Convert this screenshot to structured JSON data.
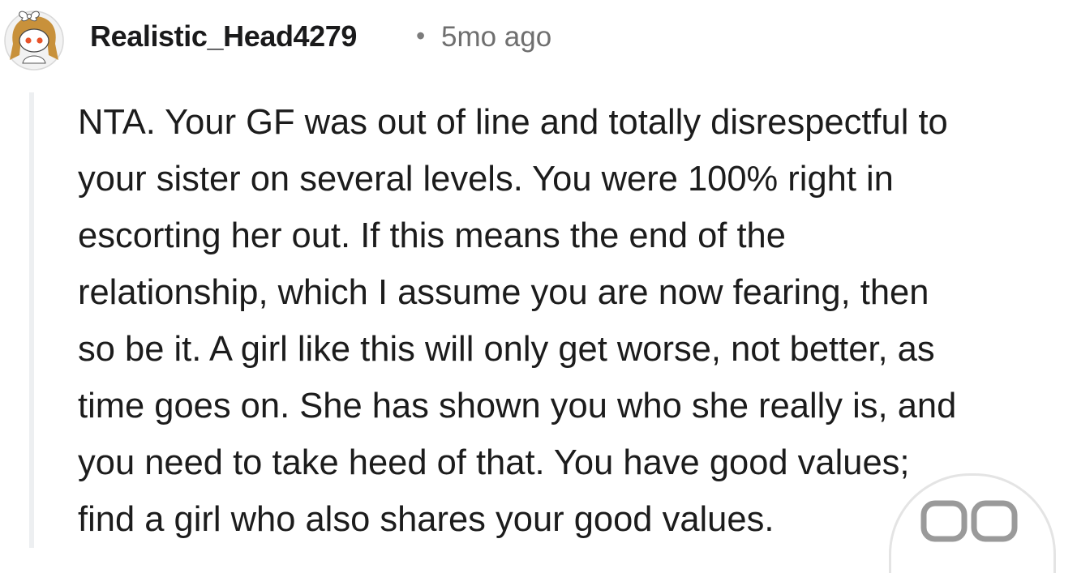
{
  "comment": {
    "username": "Realistic_Head4279",
    "separator": "•",
    "timestamp": "5mo ago",
    "avatar_icon": "reddit-snoo-avatar-icon",
    "body_lines": [
      "NTA. Your GF was out of line and totally disrespectful to",
      "your sister on several levels. You were 100% right in",
      "escorting her out. If this means the end of the",
      "relationship, which I assume you are now fearing, then",
      "so be it. A girl like this will only get worse, not better, as",
      "time goes on. She has shown you who she really is, and",
      "you need to take heed of that. You have good values;",
      "find a girl who also shares your good values."
    ]
  },
  "reaction_badge": {
    "icon": "reaction-badge-icon"
  },
  "colors": {
    "text": "#1c1c1c",
    "meta": "#6f6f6f",
    "thread_line": "#edeff1",
    "background": "#ffffff"
  }
}
